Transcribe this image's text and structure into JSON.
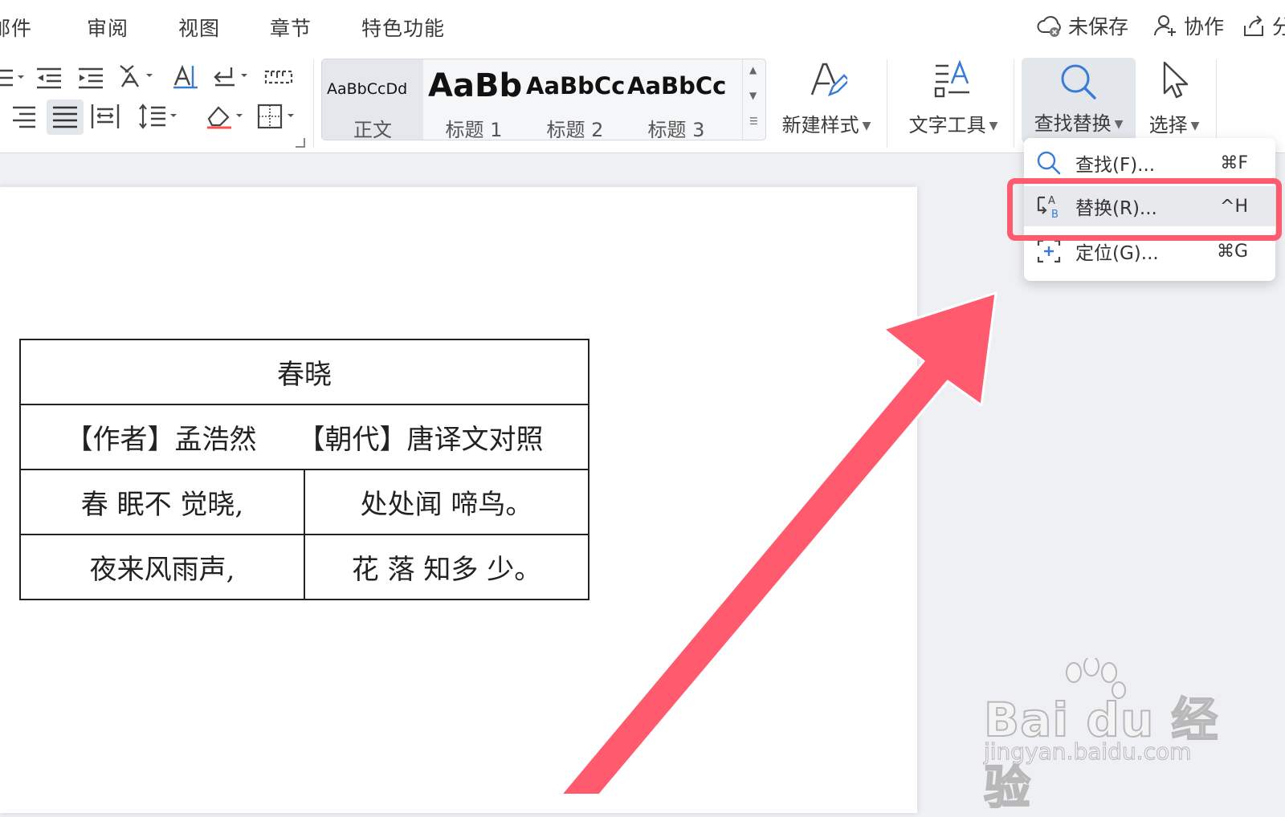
{
  "menubar": {
    "items": [
      "邮件",
      "审阅",
      "视图",
      "章节",
      "特色功能"
    ],
    "right": {
      "unsaved": "未保存",
      "collaborate": "协作",
      "share": "分"
    }
  },
  "ribbon": {
    "style_gallery": [
      {
        "preview": "AaBbCcDd",
        "label": "正文"
      },
      {
        "preview": "AaBb(",
        "label": "标题 1"
      },
      {
        "preview": "AaBbCc",
        "label": "标题 2"
      },
      {
        "preview": "AaBbCc",
        "label": "标题 3"
      }
    ],
    "new_style": "新建样式",
    "text_tools": "文字工具",
    "find_replace": "查找替换",
    "select": "选择"
  },
  "dropdown": {
    "items": [
      {
        "label": "查找(F)...",
        "shortcut": "⌘F",
        "icon": "search-icon"
      },
      {
        "label": "替换(R)...",
        "shortcut": "^H",
        "icon": "replace-icon"
      },
      {
        "label": "定位(G)...",
        "shortcut": "⌘G",
        "icon": "goto-icon"
      }
    ]
  },
  "document": {
    "title": "春晓",
    "meta_line": "【作者】孟浩然　　【朝代】唐译文对照",
    "rows": [
      [
        "春 眠不 觉晓,",
        "处处闻 啼鸟。"
      ],
      [
        "夜来风雨声,",
        "花 落 知多 少。"
      ]
    ]
  },
  "watermark": {
    "brand": "Bai du 经验",
    "url": "jingyan.baidu.com"
  },
  "colors": {
    "highlight": "#ff5a6e",
    "accent_blue": "#3a7bd5"
  }
}
